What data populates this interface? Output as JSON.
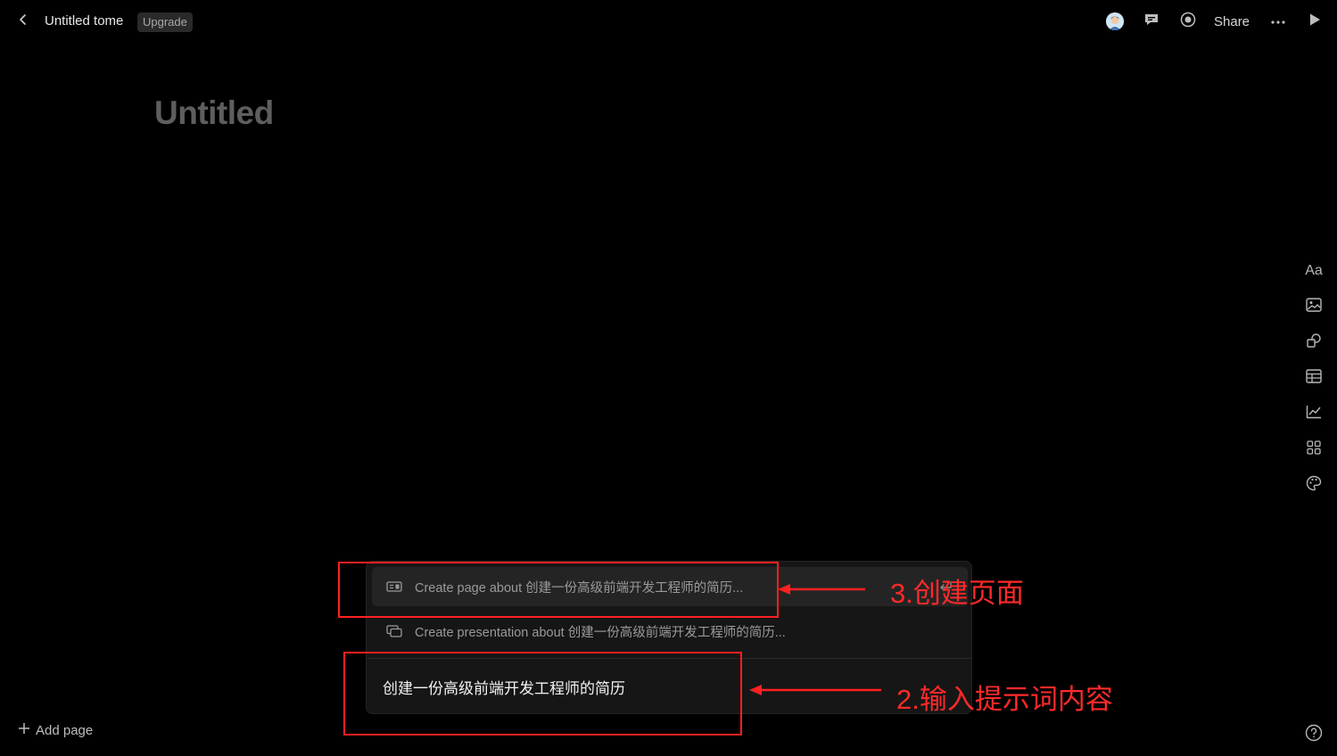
{
  "topbar": {
    "doc_title": "Untitled tome",
    "upgrade_label": "Upgrade",
    "share_label": "Share"
  },
  "page": {
    "heading": "Untitled"
  },
  "right_toolbar": {
    "text_tool_label": "Aa",
    "icons": [
      "image-icon",
      "shapes-icon",
      "table-icon",
      "chart-icon",
      "grid-icon",
      "palette-icon"
    ]
  },
  "bottom": {
    "add_page_label": "Add page"
  },
  "prompt_panel": {
    "suggestions": [
      {
        "label": "Create page about 创建一份高级前端开发工程师的简历...",
        "icon": "page-icon",
        "active": true
      },
      {
        "label": "Create presentation about 创建一份高级前端开发工程师的简历...",
        "icon": "presentation-icon",
        "active": false
      }
    ],
    "input_value": "创建一份高级前端开发工程师的简历"
  },
  "annotations": [
    {
      "label": "3.创建页面"
    },
    {
      "label": "2.输入提示词内容"
    }
  ],
  "colors": {
    "background": "#000000",
    "panel": "#161616",
    "annotation": "#ff2020"
  }
}
